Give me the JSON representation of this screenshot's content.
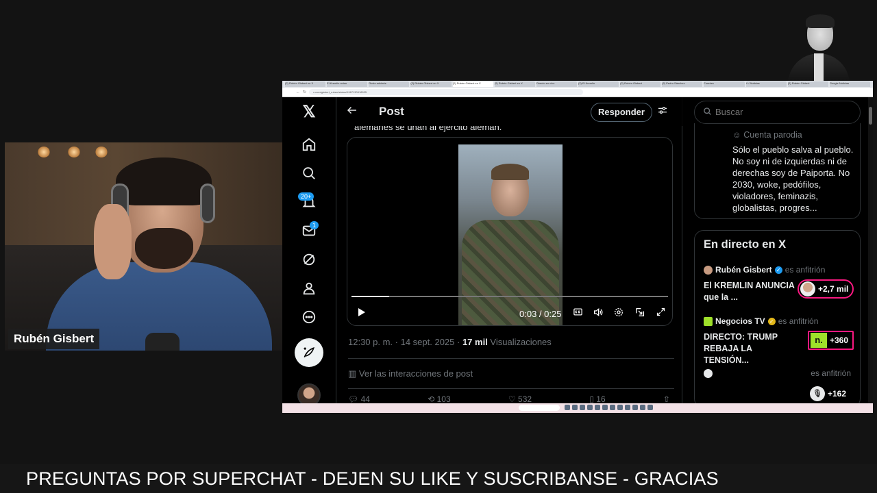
{
  "stream": {
    "presenter_name": "Rubén Gisbert",
    "ticker": "PREGUNTAS POR SUPERCHAT - DEJEN SU LIKE Y SUSCRIBANSE - GRACIAS"
  },
  "browser": {
    "tabs": [
      "(2) Rubén Gisbert en X",
      "El Kremlin avisa",
      "Rusia advierte",
      "(2) Rubén Gisbert en X",
      "(2) Rubén Gisbert en X",
      "(2) Rubén Gisbert en X",
      "Directo en vivo",
      "(2) El Kremlin",
      "(2) Rubén Gisbert",
      "(2) Pedro Sánchez",
      "Fuentes",
      "X / Noticias",
      "(2) Rubén Gisbert",
      "Google Noticias"
    ],
    "active_tab_index": 4,
    "address": "x.com/gisbert_ruben/status/1967130918935"
  },
  "x": {
    "nav": {
      "notifications_badge": "20+",
      "messages_badge": "1"
    },
    "header": {
      "title": "Post",
      "reply_label": "Responder"
    },
    "tweet": {
      "text_fragment": "alemanes se unan al ejército alemán.",
      "video_time": "0:03 / 0:25",
      "video_progress": 0.12,
      "timestamp": "12:30 p. m. · 14 sept. 2025 · ",
      "views_count": "17 mil",
      "views_label": " Visualizaciones",
      "interactions_label": "Ver las interacciones de post",
      "actions": {
        "replies": "44",
        "reposts": "103",
        "likes": "532",
        "bookmarks": "16"
      }
    },
    "search": {
      "placeholder": "Buscar"
    },
    "profile_card": {
      "parody_label": "Cuenta parodia",
      "bio": "Sólo el pueblo salva al pueblo. No soy ni de izquierdas ni de derechas soy de Paiporta. No 2030, woke, pedófilos, violadores, feminazis, globalistas, progres..."
    },
    "live": {
      "title": "En directo en X",
      "spaces": [
        {
          "host": "Rubén Gisbert",
          "role": "es anfitrión",
          "title": "El KREMLIN ANUNCIA que la ...",
          "listeners": "+2,7 mil"
        },
        {
          "host": "Negocios TV",
          "role": "es anfitrión",
          "title": "DIRECTO: TRUMP REBAJA LA TENSIÓN...",
          "listeners": "+360",
          "logo": "n."
        },
        {
          "host": "",
          "role": "es anfitrión",
          "title": "",
          "listeners": "+162"
        }
      ]
    }
  }
}
